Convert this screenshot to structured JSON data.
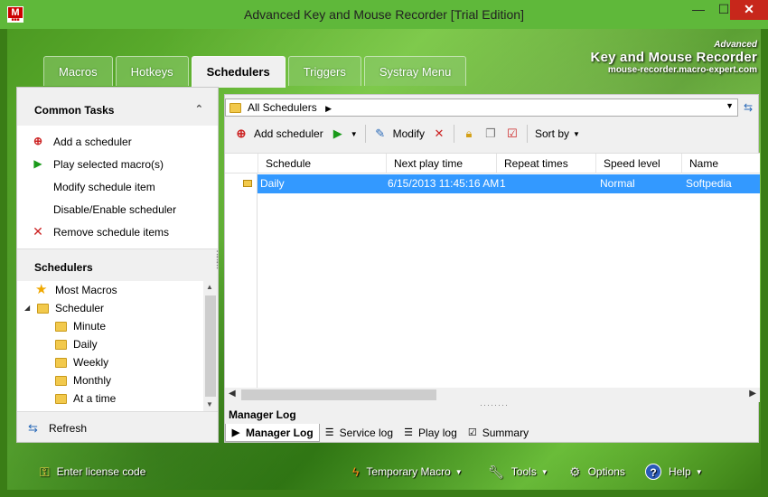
{
  "window": {
    "title": "Advanced Key and Mouse Recorder [Trial Edition]",
    "app_icon_text": "M",
    "minimize": "—",
    "maximize": "☐",
    "close": "✕"
  },
  "brand": {
    "line1": "Advanced",
    "line2": "Key and Mouse Recorder",
    "line3": "mouse-recorder.macro-expert.com"
  },
  "tabs": [
    "Macros",
    "Hotkeys",
    "Schedulers",
    "Triggers",
    "Systray Menu"
  ],
  "active_tab": "Schedulers",
  "left_panel": {
    "common_tasks_title": "Common Tasks",
    "tasks": [
      {
        "label": "Add a scheduler",
        "icon": "add-icon"
      },
      {
        "label": "Play selected macro(s)",
        "icon": "play-icon"
      },
      {
        "label": "Modify schedule item",
        "icon": ""
      },
      {
        "label": "Disable/Enable scheduler",
        "icon": ""
      },
      {
        "label": "Remove schedule items",
        "icon": "delete-icon"
      }
    ],
    "schedulers_title": "Schedulers",
    "tree": [
      {
        "label": "Most Macros",
        "level": 0,
        "icon": "star-icon"
      },
      {
        "label": "Scheduler",
        "level": 0,
        "icon": "folder-icon",
        "expanded": true
      },
      {
        "label": "Minute",
        "level": 1,
        "icon": "folder-icon"
      },
      {
        "label": "Daily",
        "level": 1,
        "icon": "folder-icon"
      },
      {
        "label": "Weekly",
        "level": 1,
        "icon": "folder-icon"
      },
      {
        "label": "Monthly",
        "level": 1,
        "icon": "folder-icon"
      },
      {
        "label": "At a time",
        "level": 1,
        "icon": "folder-icon"
      }
    ],
    "refresh_label": "Refresh"
  },
  "right_panel": {
    "address": "All Schedulers",
    "toolbar": {
      "add_scheduler": "Add scheduler",
      "modify": "Modify",
      "sort_by": "Sort by"
    },
    "columns": [
      "Schedule",
      "Next play time",
      "Repeat times",
      "Speed level",
      "Name"
    ],
    "rows": [
      {
        "schedule": "Daily",
        "next_play_time": "6/15/2013 11:45:16 AM",
        "repeat_times": "1",
        "speed_level": "Normal",
        "name": "Softpedia"
      }
    ],
    "log_title": "Manager Log",
    "log_tabs": [
      "Manager Log",
      "Service log",
      "Play log",
      "Summary"
    ],
    "active_log_tab": "Manager Log"
  },
  "bottom_bar": {
    "license": "Enter license code",
    "temporary_macro": "Temporary Macro",
    "tools": "Tools",
    "options": "Options",
    "help": "Help"
  },
  "colors": {
    "accent_green": "#5fb83a",
    "selection_blue": "#3399ff",
    "close_red": "#c7271b"
  }
}
